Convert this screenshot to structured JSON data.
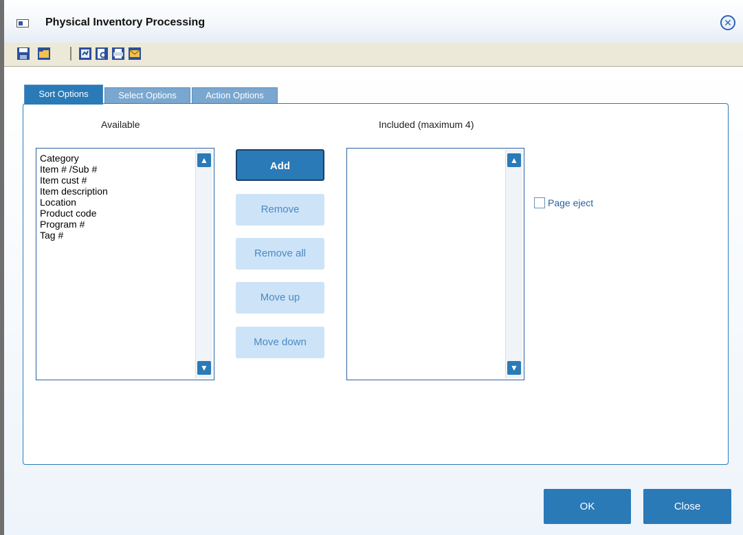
{
  "window": {
    "title": "Physical Inventory Processing"
  },
  "tabs": [
    {
      "label": "Sort Options"
    },
    {
      "label": "Select Options"
    },
    {
      "label": "Action Options"
    }
  ],
  "available": {
    "header": "Available",
    "items": [
      "Category",
      "Item # /Sub #",
      "Item cust #",
      "Item description",
      "Location",
      "Product code",
      "Program #",
      "Tag #"
    ]
  },
  "included": {
    "header": "Included (maximum 4)",
    "items": []
  },
  "buttons": {
    "add": "Add",
    "remove": "Remove",
    "remove_all": "Remove all",
    "move_up": "Move up",
    "move_down": "Move down"
  },
  "page_eject": {
    "label": "Page eject",
    "checked": false
  },
  "footer": {
    "ok": "OK",
    "close": "Close"
  },
  "icons": {
    "app": "window-icon",
    "close": "close-circle-icon",
    "scroll_up": "chevron-up-icon",
    "scroll_down": "chevron-down-icon",
    "toolbar": [
      "save-icon",
      "open-folder-icon",
      "report-icon",
      "print-preview-icon",
      "print-icon",
      "email-icon"
    ]
  },
  "colors": {
    "accent": "#2a7ab8",
    "accent_light": "#cde3f7",
    "border": "#2a5fa0"
  }
}
